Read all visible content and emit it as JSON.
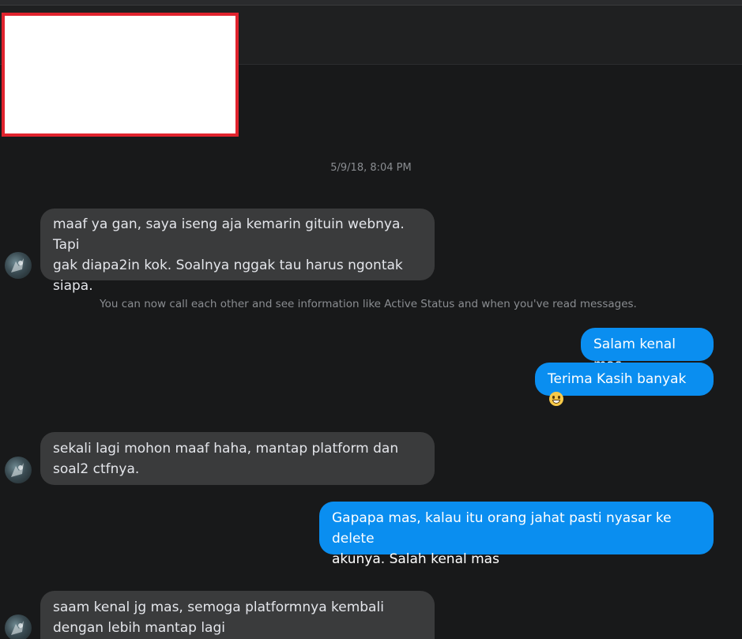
{
  "conversation": {
    "timestamp": "5/9/18, 8:04 PM",
    "system_notice": "You can now call each other and see information like Active Status and when you've read messages.",
    "messages": [
      {
        "side": "incoming",
        "text": "maaf ya gan, saya iseng aja kemarin gituin webnya. Tapi\ngak diapa2in kok. Soalnya nggak tau harus ngontak\nsiapa."
      },
      {
        "side": "outgoing",
        "text": "Salam kenal mas"
      },
      {
        "side": "outgoing",
        "text": "Terima Kasih banyak",
        "emoji": "grinning-face-emoji"
      },
      {
        "side": "incoming",
        "text": "sekali lagi mohon maaf haha, mantap platform dan\nsoal2 ctfnya."
      },
      {
        "side": "outgoing",
        "text": "Gapapa mas, kalau itu orang jahat pasti nyasar ke delete\nakunya. Salah kenal mas"
      },
      {
        "side": "incoming",
        "text": "saam kenal jg mas, semoga platformnya kembali\ndengan lebih mantap lagi"
      }
    ]
  },
  "colors": {
    "background": "#18191a",
    "incoming_bubble": "#3a3b3c",
    "outgoing_bubble": "#0a8ef0",
    "redaction_border": "#e0232d"
  }
}
